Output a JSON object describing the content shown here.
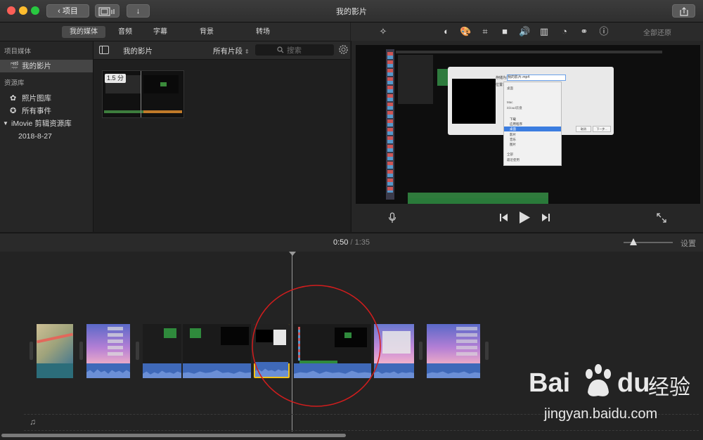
{
  "window": {
    "title": "我的影片",
    "back_button": "项目",
    "reset_all": "全部还原"
  },
  "media_tabs": [
    "我的媒体",
    "音频",
    "字幕",
    "背景",
    "转场"
  ],
  "sidebar": {
    "project_media_heading": "项目媒体",
    "project_item": "我的影片",
    "libraries_heading": "资源库",
    "items": [
      "照片图库",
      "所有事件",
      "iMovie 剪辑资源库",
      "2018-8-27"
    ]
  },
  "browser": {
    "title": "我的影片",
    "filter": "所有片段",
    "search_placeholder": "搜索",
    "clip_duration": "1.5 分"
  },
  "preview_dialog": {
    "save_as_label": "存储为:",
    "save_as_value": "我的影片.mp4",
    "where_label": "位置:",
    "folders": [
      "下载",
      "应用程序",
      "桌面",
      "影片",
      "音乐",
      "图片"
    ],
    "sidebar_entries": [
      "桌面",
      "Mac",
      "iCloud云盘",
      "全部",
      "最近使用"
    ],
    "cancel": "取消",
    "next": "下一步..."
  },
  "timeline": {
    "current_time": "0:50",
    "separator": "/",
    "total_time": "1:35",
    "settings": "设置",
    "zoom_level": 0.2
  },
  "watermark": {
    "brand": "Bai",
    "brand_suffix": "du",
    "cn": "经验",
    "url": "jingyan.baidu.com"
  },
  "colors": {
    "selected_clip_border": "#f2c21b",
    "audio_wave": "#3f69b9",
    "annotation_circle": "#d21d1d"
  }
}
